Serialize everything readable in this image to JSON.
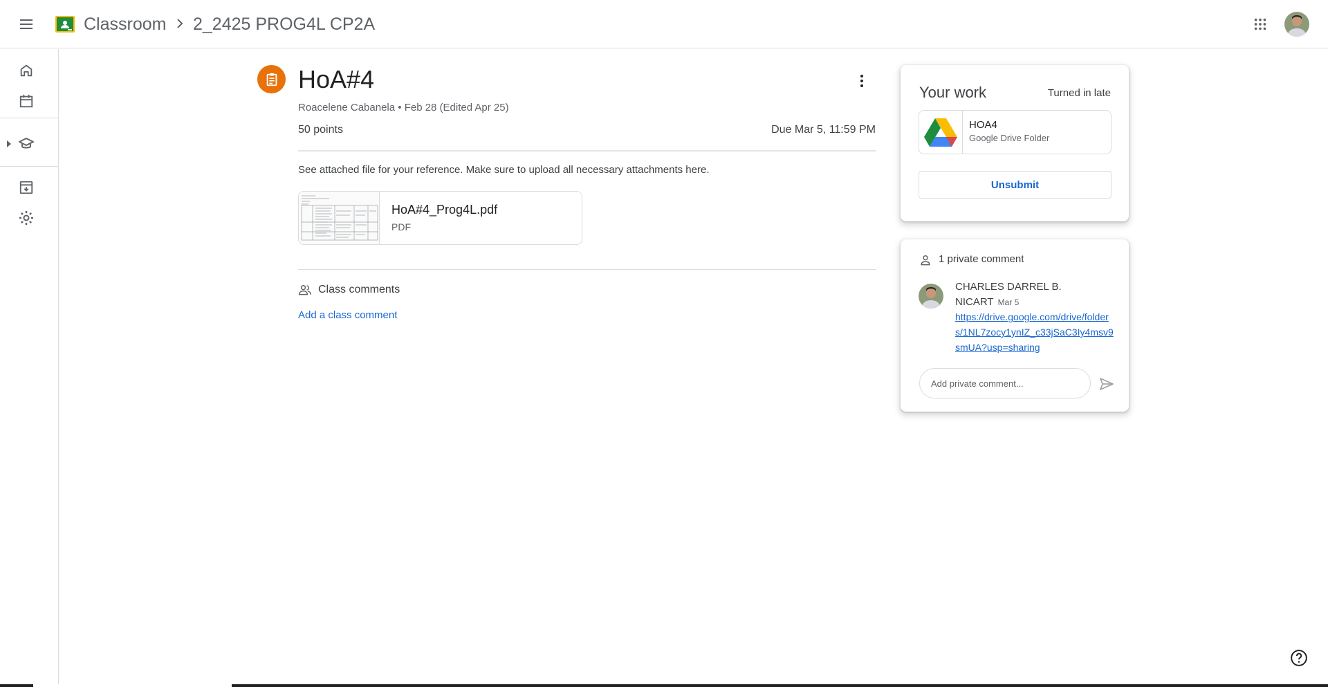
{
  "header": {
    "app_name": "Classroom",
    "class_name": "2_2425 PROG4L CP2A",
    "logo_color": "#1e8e3e",
    "logo_accent": "#fbbc04"
  },
  "rail": {
    "items": [
      "home-icon",
      "calendar-icon",
      "enrolled-icon",
      "archive-icon",
      "settings-icon"
    ]
  },
  "assignment": {
    "title": "HoA#4",
    "meta": "Roacelene Cabanela • Feb 28 (Edited Apr 25)",
    "points": "50 points",
    "due": "Due Mar 5, 11:59 PM",
    "description": "See attached file for your reference. Make sure to upload all necessary attachments here.",
    "icon_color": "#e8710a",
    "attachment": {
      "name": "HoA#4_Prog4L.pdf",
      "type": "PDF"
    }
  },
  "class_comments": {
    "label": "Class comments",
    "add_label": "Add a class comment"
  },
  "your_work": {
    "title": "Your work",
    "status": "Turned in late",
    "file": {
      "name": "HOA4",
      "type": "Google Drive Folder"
    },
    "unsubmit_label": "Unsubmit"
  },
  "private_comments": {
    "label": "1 private comment",
    "comment": {
      "author": "CHARLES DARREL B. NICART",
      "date": "Mar 5",
      "text": "https://drive.google.com/drive/folders/1NL7zocy1ynIZ_c33jSaC3Iy4msv9smUA?usp=sharing"
    },
    "input_placeholder": "Add private comment..."
  },
  "accent_color": "#1967d2"
}
